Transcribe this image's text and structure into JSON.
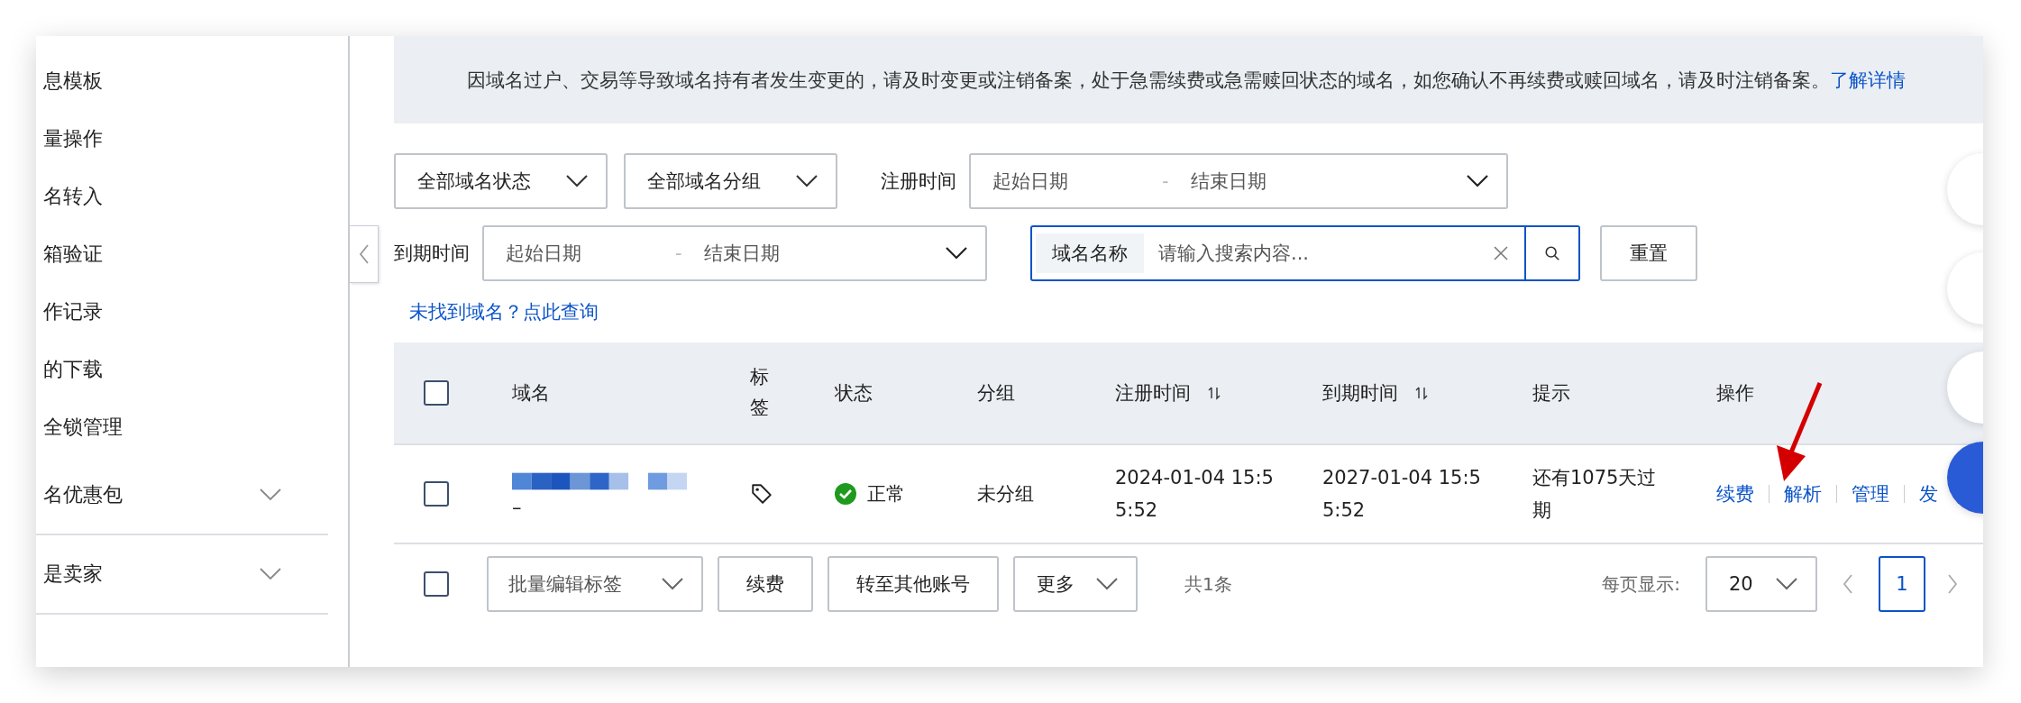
{
  "sidebar": {
    "items": [
      {
        "kind": "item",
        "label": "息模板"
      },
      {
        "kind": "item",
        "label": "量操作"
      },
      {
        "kind": "item",
        "label": "名转入"
      },
      {
        "kind": "item",
        "label": "箱验证"
      },
      {
        "kind": "item",
        "label": "作记录"
      },
      {
        "kind": "item",
        "label": "的下载"
      },
      {
        "kind": "item",
        "label": "全锁管理"
      },
      {
        "kind": "group",
        "label": "名优惠包",
        "expanded": false
      },
      {
        "kind": "group",
        "label": "是卖家",
        "expanded": false
      }
    ]
  },
  "notice": {
    "text": "因域名过户、交易等导致域名持有者发生变更的，请及时变更或注销备案，处于急需续费或急需赎回状态的域名，如您确认不再续费或赎回域名，请及时注销备案。",
    "link": "了解详情"
  },
  "filters": {
    "status_select": "全部域名状态",
    "group_select": "全部域名分组",
    "registration": {
      "label": "注册时间",
      "start_placeholder": "起始日期",
      "separator": "-",
      "end_placeholder": "结束日期"
    },
    "expiry": {
      "label": "到期时间",
      "start_placeholder": "起始日期",
      "separator": "-",
      "end_placeholder": "结束日期"
    },
    "search": {
      "label": "域名名称",
      "placeholder": "请输入搜索内容..."
    },
    "reset_button": "重置"
  },
  "not_found_link": "未找到域名？点此查询",
  "table": {
    "columns": [
      {
        "label": "域名",
        "sortable": false
      },
      {
        "label": "标签",
        "sortable": false
      },
      {
        "label": "状态",
        "sortable": false
      },
      {
        "label": "分组",
        "sortable": false
      },
      {
        "label": "注册时间",
        "sortable": true
      },
      {
        "label": "到期时间",
        "sortable": true
      },
      {
        "label": "提示",
        "sortable": false
      },
      {
        "label": "操作",
        "sortable": false
      }
    ],
    "header_checked": false,
    "rows": [
      {
        "checked": false,
        "domain_suffix": "–",
        "status": "正常",
        "group": "未分组",
        "registered": "2024-01-04 15:55:52",
        "expires": "2027-01-04 15:55:52",
        "hint": "还有1075天过期",
        "actions": [
          "续费",
          "解析",
          "管理",
          "发"
        ]
      }
    ]
  },
  "footer": {
    "checked": false,
    "batch_select": "批量编辑标签",
    "buttons": [
      "续费",
      "转至其他账号"
    ],
    "more_select": "更多",
    "count": "共1条",
    "page_size_label": "每页显示:",
    "page_size": "20",
    "pages": [
      {
        "label": "1",
        "selected": true
      }
    ]
  }
}
